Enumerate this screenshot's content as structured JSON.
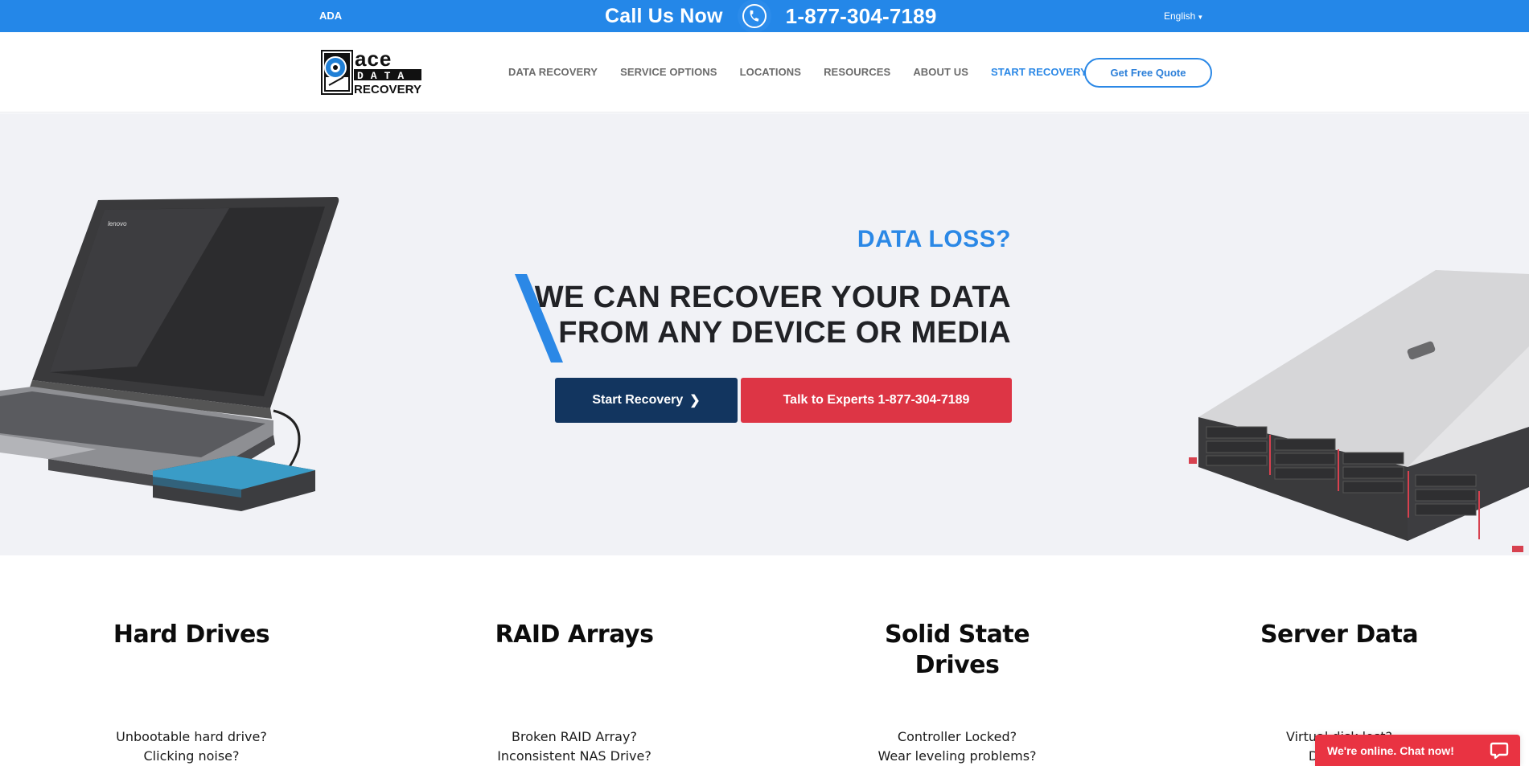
{
  "topbar": {
    "ada_label": "ADA",
    "call_label": "Call Us Now",
    "phone": "1-877-304-7189",
    "language": "English",
    "bg_color": "#2487e8"
  },
  "header": {
    "logo_text": [
      "ace",
      "DATA",
      "RECOVERY"
    ],
    "nav": [
      {
        "label": "DATA RECOVERY",
        "active": false
      },
      {
        "label": "SERVICE OPTIONS",
        "active": false
      },
      {
        "label": "LOCATIONS",
        "active": false
      },
      {
        "label": "RESOURCES",
        "active": false
      },
      {
        "label": "ABOUT US",
        "active": false
      },
      {
        "label": "START RECOVERY",
        "active": true
      }
    ],
    "quote_label": "Get Free Quote"
  },
  "hero": {
    "eyebrow": "DATA LOSS?",
    "headline_line1": "WE CAN RECOVER YOUR DATA",
    "headline_line2": "FROM ANY DEVICE OR MEDIA",
    "start_button": "Start Recovery",
    "talk_button": "Talk to Experts 1-877-304-7189",
    "laptop_brand": "lenovo",
    "colors": {
      "accent": "#2b88e6",
      "navy": "#12355f",
      "red": "#dd3545"
    }
  },
  "features": [
    {
      "title": "Hard Drives",
      "questions": [
        "Unbootable hard drive?",
        "Clicking noise?"
      ]
    },
    {
      "title": "RAID Arrays",
      "questions": [
        "Broken RAID Array?",
        "Inconsistent NAS Drive?"
      ]
    },
    {
      "title_line1": "Solid State",
      "title_line2": "Drives",
      "questions": [
        "Controller Locked?",
        "Wear leveling problems?"
      ]
    },
    {
      "title": "Server Data",
      "questions": [
        "Virtual disk lost?",
        "Database"
      ]
    }
  ],
  "chat": {
    "label": "We're online. Chat now!"
  }
}
